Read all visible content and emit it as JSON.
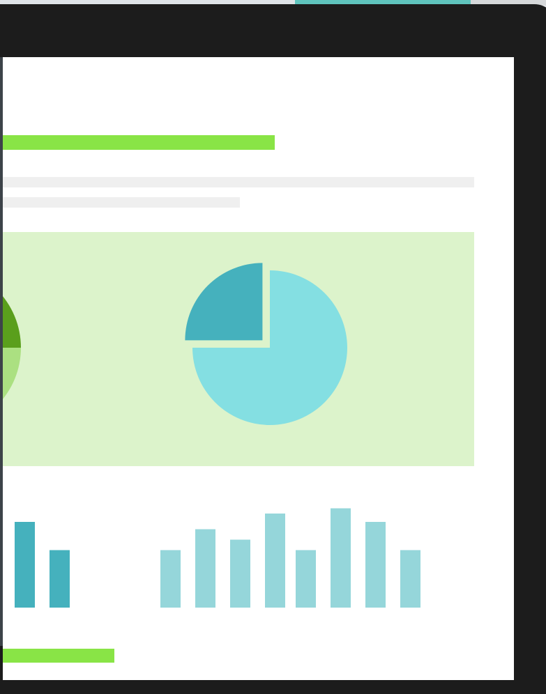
{
  "colors": {
    "page_background": "#e9ebee",
    "device_frame": "#1c1c1c",
    "screen": "#ffffff",
    "accent_green": "#89e446",
    "placeholder_gray": "#efefef",
    "chart_panel": "#dcf3cb",
    "teal_dark": "#45b1bd",
    "teal_light": "#84dfe2",
    "teal_muted": "#95d6da",
    "green_dark": "#5a9f1c",
    "green_light": "#abe081"
  },
  "chart_data": [
    {
      "type": "pie",
      "values": [
        25,
        75
      ],
      "colors": [
        "#45b1bd",
        "#84dfe2"
      ],
      "exploded": [
        true,
        false
      ]
    },
    {
      "type": "bar",
      "values": [
        5.5,
        7.5,
        6.5,
        9,
        5.5,
        9.5,
        8.2,
        5.5
      ],
      "color": "#95d6da"
    },
    {
      "type": "bar",
      "values": [
        8.2,
        5.5
      ],
      "color": "#45b1bd"
    }
  ]
}
